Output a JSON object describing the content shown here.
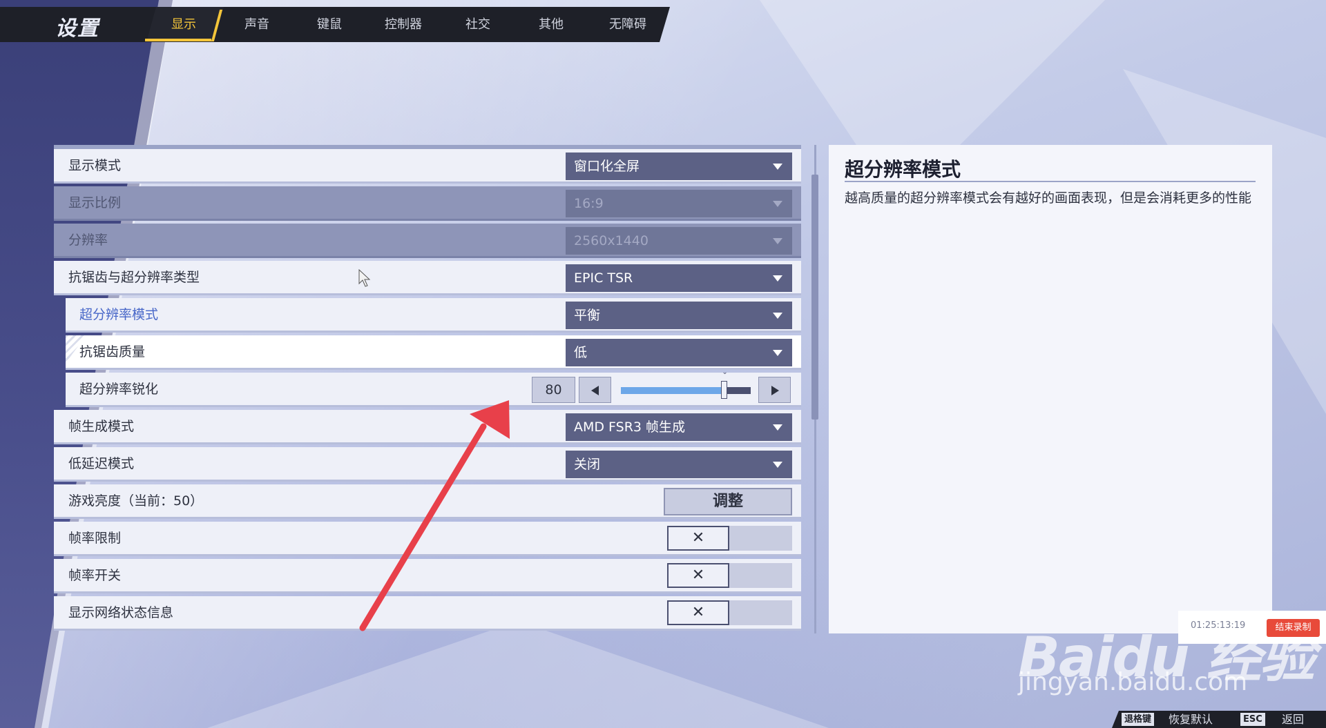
{
  "header": {
    "title": "设置",
    "tabs": [
      {
        "label": "显示",
        "active": true
      },
      {
        "label": "声音",
        "active": false
      },
      {
        "label": "键鼠",
        "active": false
      },
      {
        "label": "控制器",
        "active": false
      },
      {
        "label": "社交",
        "active": false
      },
      {
        "label": "其他",
        "active": false
      },
      {
        "label": "无障碍",
        "active": false
      }
    ]
  },
  "settings": {
    "display_mode": {
      "label": "显示模式",
      "value": "窗口化全屏"
    },
    "aspect_ratio": {
      "label": "显示比例",
      "value": "16:9"
    },
    "resolution": {
      "label": "分辨率",
      "value": "2560x1440"
    },
    "aa_upscale_type": {
      "label": "抗锯齿与超分辨率类型",
      "value": "EPIC TSR"
    },
    "upscale_mode": {
      "label": "超分辨率模式",
      "value": "平衡"
    },
    "aa_quality": {
      "label": "抗锯齿质量",
      "value": "低"
    },
    "upscale_sharpen": {
      "label": "超分辨率锐化",
      "value": "80",
      "level_percent": 80
    },
    "frame_gen": {
      "label": "帧生成模式",
      "value": "AMD FSR3 帧生成"
    },
    "low_latency": {
      "label": "低延迟模式",
      "value": "关闭"
    },
    "brightness": {
      "label": "游戏亮度（当前：50）",
      "button": "调整"
    },
    "fps_limit": {
      "label": "帧率限制",
      "state": "off"
    },
    "fps_toggle": {
      "label": "帧率开关",
      "state": "off"
    },
    "network_info": {
      "label": "显示网络状态信息",
      "state": "off"
    }
  },
  "toggle_off_glyph": "✕",
  "info": {
    "title": "超分辨率模式",
    "description": "越高质量的超分辨率模式会有越好的画面表现，但是会消耗更多的性能"
  },
  "recorder": {
    "time": "01:25:13:19",
    "stop_label": "结束录制"
  },
  "watermark": {
    "main": "Baidu 经验",
    "sub": "jingyan.baidu.com"
  },
  "footer": {
    "reset_key": "退格键",
    "reset_label": "恢复默认",
    "back_key": "ESC",
    "back_label": "返回"
  },
  "colors": {
    "accent": "#f4c53a",
    "dropdown_bg": "#5c6185",
    "selected_label": "#4867c8",
    "slider_fill": "#6da7e8",
    "stop_button": "#e84a3a"
  }
}
